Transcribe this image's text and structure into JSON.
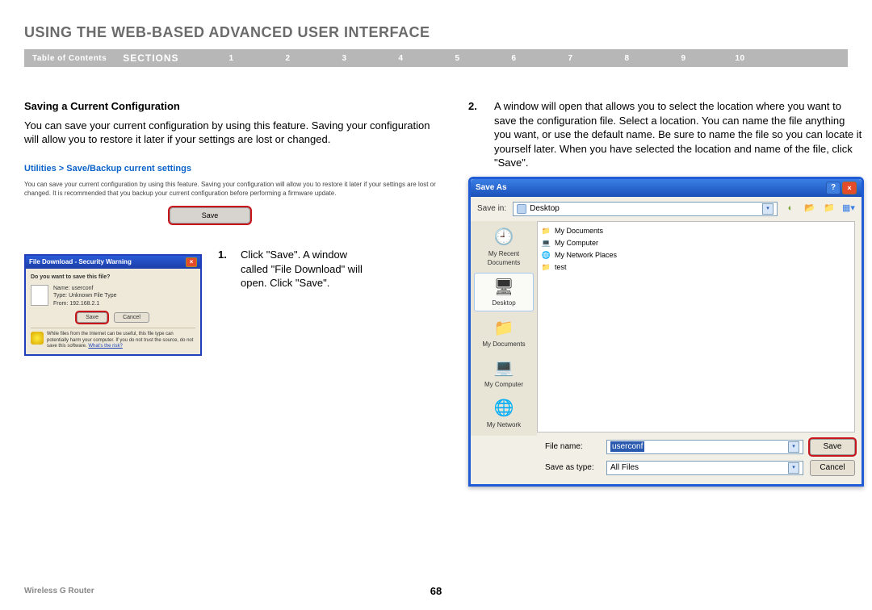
{
  "page_title": "USING THE WEB-BASED ADVANCED USER INTERFACE",
  "nav": {
    "toc": "Table of Contents",
    "sections_label": "SECTIONS",
    "items": [
      "1",
      "2",
      "3",
      "4",
      "5",
      "6",
      "7",
      "8",
      "9",
      "10"
    ],
    "active_index": 5
  },
  "left": {
    "subhead": "Saving a Current Configuration",
    "intro": "You can save your current configuration by using this feature. Saving your configuration will allow you to restore it later if your settings are lost or changed.",
    "breadcrumb": "Utilities > Save/Backup current settings",
    "tiny_desc": "You can save your current configuration by using this feature. Saving your configuration will allow you to restore it later if your settings are lost or changed. It is recommended that you backup your current configuration before performing a firmware update.",
    "save_btn": "Save",
    "step1_num": "1.",
    "step1_text": "Click \"Save\". A window called \"File Download\" will open. Click \"Save\".",
    "dlg": {
      "title": "File Download - Security Warning",
      "question": "Do you want to save this file?",
      "name_lbl": "Name:",
      "name_val": "userconf",
      "type_lbl": "Type:",
      "type_val": "Unknown File Type",
      "from_lbl": "From:",
      "from_val": "192.168.2.1",
      "save": "Save",
      "cancel": "Cancel",
      "warn": "While files from the Internet can be useful, this file type can potentially harm your computer. If you do not trust the source, do not save this software.",
      "warn_link": "What's the risk?"
    }
  },
  "right": {
    "step2_num": "2.",
    "step2_text": "A window will open that allows you to select the location where you want to save the configuration file. Select a location. You can name the file anything you want, or use the default name. Be sure to name the file so you can locate it yourself later. When you have selected the location and name of the file, click \"Save\".",
    "saveas": {
      "title": "Save As",
      "savein_lbl": "Save in:",
      "savein_val": "Desktop",
      "side": [
        {
          "label": "My Recent Documents",
          "icon": "🕘"
        },
        {
          "label": "Desktop",
          "icon": "🖥",
          "selected": true
        },
        {
          "label": "My Documents",
          "icon": "📁"
        },
        {
          "label": "My Computer",
          "icon": "💻"
        },
        {
          "label": "My Network",
          "icon": "🌐"
        }
      ],
      "pane": [
        {
          "icon": "📁",
          "label": "My Documents"
        },
        {
          "icon": "💻",
          "label": "My Computer"
        },
        {
          "icon": "🌐",
          "label": "My Network Places"
        },
        {
          "icon": "📁",
          "label": "test"
        }
      ],
      "fname_lbl": "File name:",
      "fname_val": "userconf",
      "ftype_lbl": "Save as type:",
      "ftype_val": "All Files",
      "save": "Save",
      "cancel": "Cancel"
    }
  },
  "footer": {
    "left": "Wireless G Router",
    "page": "68"
  }
}
